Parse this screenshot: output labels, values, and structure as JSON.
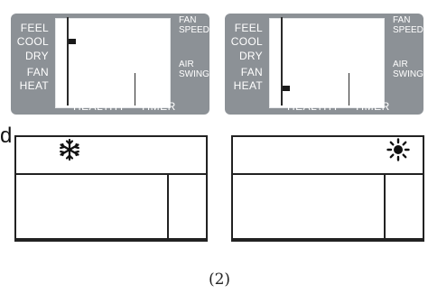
{
  "figure_caption": "(2)",
  "side_text": "d",
  "lcd_panels": [
    {
      "modes": [
        "FEEL",
        "COOL",
        "DRY",
        "FAN",
        "HEAT"
      ],
      "active_mode": "COOL",
      "right_labels": [
        "FAN",
        "SPEED",
        "AIR",
        "SWING"
      ],
      "bottom_left": "HEALTHY",
      "bottom_right": "TIMER"
    },
    {
      "modes": [
        "FEEL",
        "COOL",
        "DRY",
        "FAN",
        "HEAT"
      ],
      "active_mode": "HEAT",
      "right_labels": [
        "FAN",
        "SPEED",
        "AIR",
        "SWING"
      ],
      "bottom_left": "HEALTHY",
      "bottom_right": "TIMER"
    }
  ],
  "boxes": [
    {
      "icon": "snowflake-icon"
    },
    {
      "icon": "sun-icon"
    }
  ],
  "colors": {
    "lcd_bg": "#8c9196",
    "line": "#222222"
  }
}
